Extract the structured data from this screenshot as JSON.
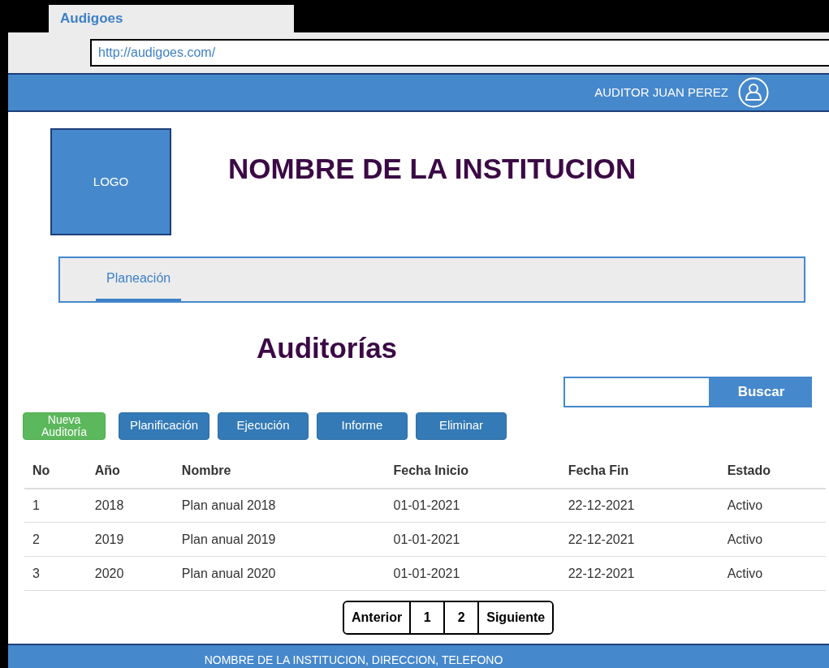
{
  "browser": {
    "tab_title": "Audigoes",
    "url": "http://audigoes.com/"
  },
  "header": {
    "user": "AUDITOR JUAN PEREZ"
  },
  "logo": "LOGO",
  "institution": "NOMBRE DE LA INSTITUCION",
  "nav": [
    {
      "label": "Planeación",
      "selected": true
    }
  ],
  "page_title": "Auditorías",
  "search": {
    "button": "Buscar"
  },
  "actions": [
    {
      "label": "Nueva Auditoría",
      "kind": "primary"
    },
    {
      "label": "Planificación",
      "kind": "default"
    },
    {
      "label": "Ejecución",
      "kind": "default"
    },
    {
      "label": "Informe",
      "kind": "default"
    },
    {
      "label": "Eliminar",
      "kind": "default"
    }
  ],
  "table": {
    "columns": [
      "No",
      "Año",
      "Nombre",
      "Fecha Inicio",
      "Fecha Fin",
      "Estado"
    ],
    "rows": [
      [
        "1",
        "2018",
        "Plan anual 2018",
        "01-01-2021",
        "22-12-2021",
        "Activo"
      ],
      [
        "2",
        "2019",
        "Plan anual 2019",
        "01-01-2021",
        "22-12-2021",
        "Activo"
      ],
      [
        "3",
        "2020",
        "Plan anual 2020",
        "01-01-2021",
        "22-12-2021",
        "Activo"
      ]
    ]
  },
  "pagination": [
    "Anterior",
    "1",
    "2",
    "Siguiente"
  ],
  "footer": "NOMBRE DE LA INSTITUCION, DIRECCION, TELEFONO"
}
